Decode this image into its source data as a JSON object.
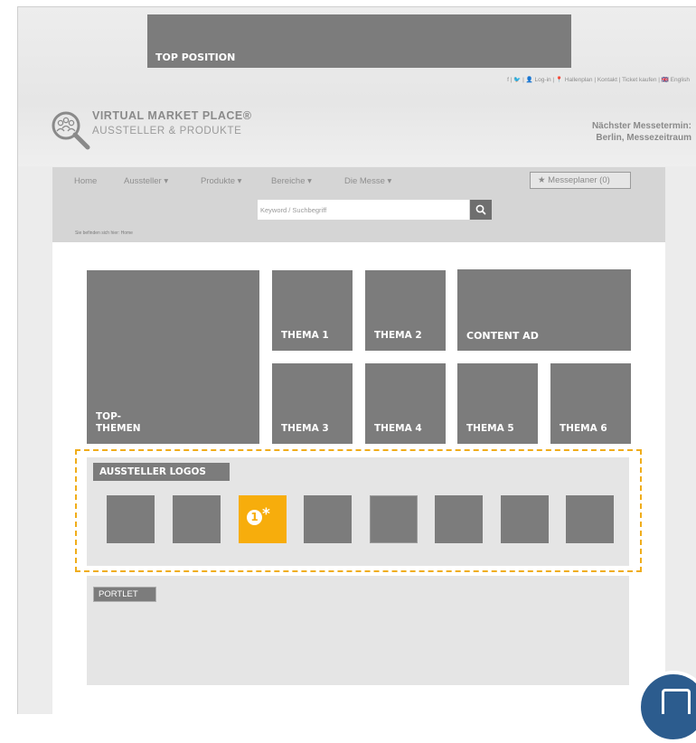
{
  "top_position": {
    "label": "TOP POSITION"
  },
  "utility_links": "f | 🐦 | 👤 Log-in | 📍 Hallenplan | Kontakt | Ticket kaufen | 🇬🇧 English",
  "brand": {
    "title": "VIRTUAL MARKET PLACE®",
    "subtitle": "AUSSTELLER & PRODUKTE"
  },
  "next_fair": {
    "line1": "Nächster Messetermin:",
    "line2": "Berlin, Messezeitraum"
  },
  "nav": {
    "items": [
      {
        "label": "Home"
      },
      {
        "label": "Aussteller ▾"
      },
      {
        "label": "Produkte ▾"
      },
      {
        "label": "Bereiche ▾"
      },
      {
        "label": "Die Messe ▾"
      }
    ],
    "planer": "★ Messeplaner (0)"
  },
  "search": {
    "placeholder": "Keyword / Suchbegriff",
    "icon": "search-icon"
  },
  "breadcrumb": "Sie befinden sich hier:   Home",
  "tiles": {
    "top_themen_line1": "TOP-",
    "top_themen_line2": "THEMEN",
    "thema1": "THEMA 1",
    "thema2": "THEMA 2",
    "content_ad": "CONTENT AD",
    "thema3": "THEMA 3",
    "thema4": "THEMA 4",
    "thema5": "THEMA 5",
    "thema6": "THEMA 6"
  },
  "logos": {
    "title": "AUSSTELLER LOGOS",
    "highlight_number": "1",
    "highlight_star": "*",
    "highlight_color": "#f7ad0c",
    "dash_color": "#f0ad1a"
  },
  "portlet": {
    "label": "PORTLET"
  },
  "colors": {
    "block": "#7c7c7c",
    "chat": "#2c5c8e"
  }
}
